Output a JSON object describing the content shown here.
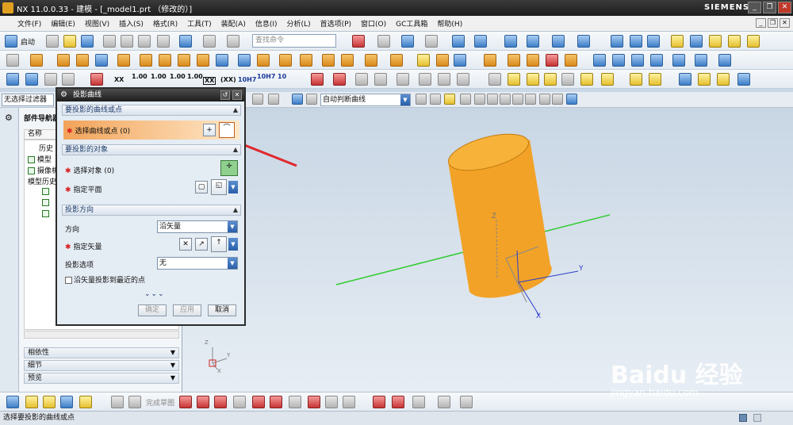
{
  "app": {
    "title": "NX 11.0.0.33 - 建模 - [_model1.prt （修改的）]",
    "brand": "SIEMENS"
  },
  "window_buttons": [
    "_",
    "❐",
    "✕"
  ],
  "menu": [
    "文件(F)",
    "编辑(E)",
    "视图(V)",
    "插入(S)",
    "格式(R)",
    "工具(T)",
    "装配(A)",
    "信息(I)",
    "分析(L)",
    "首选项(P)",
    "窗口(O)",
    "GC工具箱",
    "帮助(H)"
  ],
  "toolbar": {
    "start_label": "启动",
    "search_placeholder": "查找命令",
    "dims": [
      "XX",
      "1.00",
      "1.00",
      "1.00",
      "1.00",
      "XX",
      "(XX)",
      "10H7",
      "10H7",
      "10"
    ]
  },
  "filter": {
    "selection_filter": "无选择过滤器",
    "curve_rule": "自动判断曲线"
  },
  "navigator": {
    "title": "部件导航器",
    "column": "名称",
    "rows": [
      "历史",
      "模型",
      "摄像机",
      "模型历史"
    ],
    "accordion": [
      "相依性",
      "细节",
      "预览"
    ]
  },
  "dialog": {
    "title": "投影曲线",
    "sections": {
      "curves": "要投影的曲线或点",
      "objects": "要投影的对象",
      "direction": "投影方向"
    },
    "select_curve": "选择曲线或点 (0)",
    "select_object": "选择对象 (0)",
    "specify_plane": "指定平面",
    "direction_label": "方向",
    "direction_value": "沿矢量",
    "specify_vector": "指定矢量",
    "projection_option_label": "投影选项",
    "projection_option_value": "无",
    "checkbox_label": "沿矢量投影到最近的点",
    "buttons": {
      "ok": "确定",
      "apply": "应用",
      "cancel": "取消"
    }
  },
  "bottom_toolbar": {
    "sketch_label": "完成草图"
  },
  "status": "选择要投影的曲线或点",
  "watermark": {
    "text": "Baidu 经验",
    "url": "jingyan.baidu.com"
  },
  "axes": {
    "x": "X",
    "y": "Y",
    "z": "Z"
  },
  "colors": {
    "accent": "#2b5f99",
    "cylinder": "#f2a227",
    "highlight": "#f2a35a"
  }
}
